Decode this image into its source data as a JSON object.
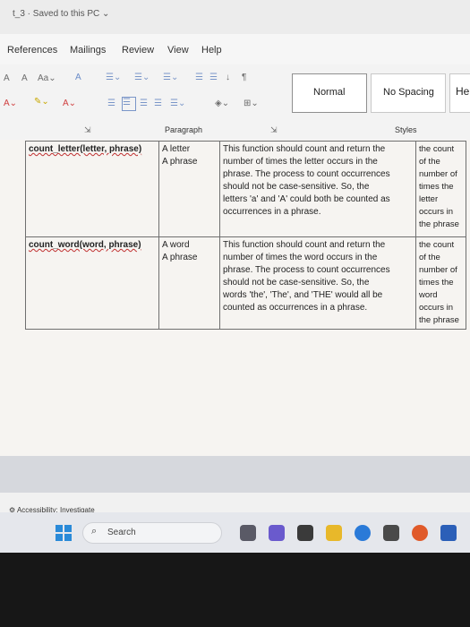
{
  "titlebar": {
    "text": "t_3 · Saved to this PC ⌄"
  },
  "menu": {
    "references": "References",
    "mailings": "Mailings",
    "review": "Review",
    "view": "View",
    "help": "Help"
  },
  "ribbon": {
    "styles": {
      "normal": "Normal",
      "no_spacing": "No Spacing",
      "heading_partial": "He"
    },
    "groups": {
      "paragraph": "Paragraph",
      "styles": "Styles"
    }
  },
  "table": {
    "rows": [
      {
        "fn": "count_letter(letter, phrase)",
        "params": [
          "A letter",
          "A phrase"
        ],
        "desc_lines": [
          "This function should count and return the",
          "number of times the letter occurs in the",
          "phrase. The process to count occurrences",
          "should not be case-sensitive. So, the",
          "letters 'a' and 'A' could both be counted as",
          "occurrences in a phrase."
        ],
        "ret_lines": [
          "the count",
          "of the",
          "number of",
          "times the",
          "letter",
          "occurs in",
          "the phrase"
        ]
      },
      {
        "fn": "count_word(word, phrase)",
        "params": [
          "A word",
          "A phrase"
        ],
        "desc_lines": [
          "This function should count and return the",
          "number of times the word occurs in the",
          "phrase. The process to count occurrences",
          "should not be case-sensitive. So, the",
          "words 'the', 'The', and 'THE' would all be",
          "counted as occurrences in a phrase."
        ],
        "ret_lines": [
          "the count",
          "of the",
          "number of",
          "times the",
          "word",
          "occurs in",
          "the phrase"
        ]
      }
    ]
  },
  "status": {
    "accessibility": "Accessibility: Investigate"
  },
  "taskbar": {
    "search": "Search"
  }
}
